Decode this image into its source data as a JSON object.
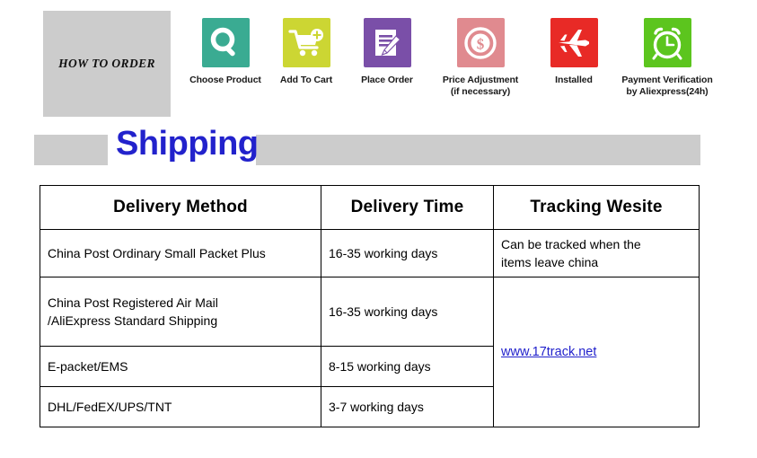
{
  "how_to_order": {
    "label": "HOW TO ORDER",
    "box_color": "#cccccc"
  },
  "steps": [
    {
      "label": "Choose Product",
      "icon": "magnifier-icon",
      "color": "#3aab92"
    },
    {
      "label": "Add To Cart",
      "icon": "shopping-cart-plus-icon",
      "color": "#ccd633"
    },
    {
      "label": "Place Order",
      "icon": "document-pen-icon",
      "color": "#7a4fa8"
    },
    {
      "label": "Price  Adjustment\n(if necessary)",
      "icon": "dollar-coin-icon",
      "color": "#e08a8f"
    },
    {
      "label": "Installed",
      "icon": "airplane-icon",
      "color": "#e82a26"
    },
    {
      "label": "Payment Verification\nby Aliexpress(24h)",
      "icon": "alarm-clock-icon",
      "color": "#5cc51e"
    }
  ],
  "shipping_banner": {
    "title": "Shipping",
    "title_color": "#2222cc",
    "bar_color": "#cccccc"
  },
  "table": {
    "headers": [
      "Delivery Method",
      "Delivery Time",
      "Tracking Wesite"
    ],
    "rows": [
      {
        "method": "China Post Ordinary Small Packet Plus",
        "time": "16-35 working days",
        "tracking": "Can be tracked when the\nitems leave china"
      },
      {
        "method": "China Post Registered Air Mail\n/AliExpress Standard Shipping",
        "time": "16-35 working days"
      },
      {
        "method": "E-packet/EMS",
        "time": "8-15 working days"
      },
      {
        "method": "DHL/FedEX/UPS/TNT",
        "time": "3-7 working days"
      }
    ],
    "tracking_link": "www.17track.net",
    "tracking_link_color": "#2222cc"
  }
}
